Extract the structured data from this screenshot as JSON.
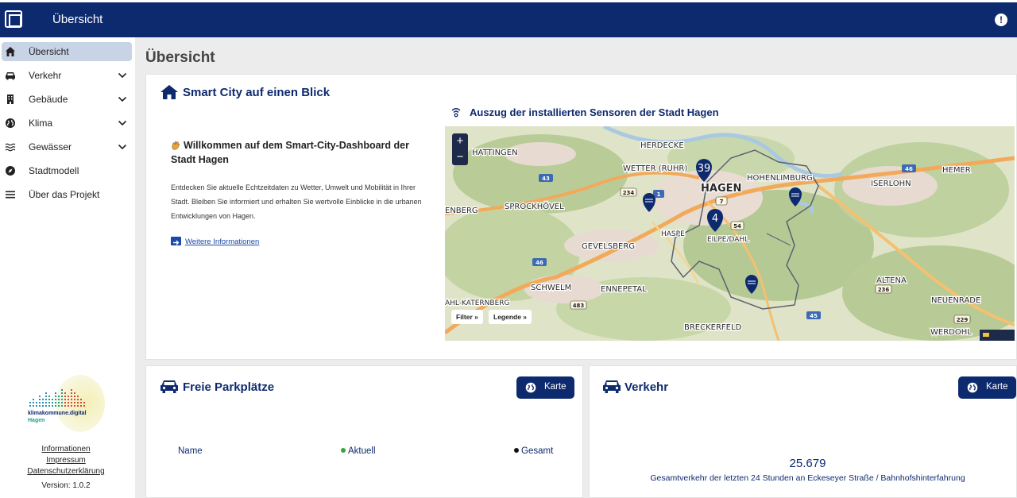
{
  "header": {
    "title": "Übersicht",
    "alert_icon": "alert-circle-icon"
  },
  "sidebar": {
    "items": [
      {
        "label": "Übersicht",
        "icon": "home-icon",
        "expandable": false,
        "active": true
      },
      {
        "label": "Verkehr",
        "icon": "car-icon",
        "expandable": true
      },
      {
        "label": "Gebäude",
        "icon": "building-icon",
        "expandable": true
      },
      {
        "label": "Klima",
        "icon": "globe-icon",
        "expandable": true
      },
      {
        "label": "Gewässer",
        "icon": "water-icon",
        "expandable": true
      },
      {
        "label": "Stadtmodell",
        "icon": "compass-icon",
        "expandable": false
      },
      {
        "label": "Über das Projekt",
        "icon": "menu-icon",
        "expandable": false
      }
    ],
    "logo_text": "klimakommune.digital",
    "logo_sub": "Hagen",
    "footer_links": [
      "Informationen",
      "Impressum",
      "Datenschutzerklärung"
    ],
    "version": "Version: 1.0.2"
  },
  "main": {
    "page_title": "Übersicht",
    "overview": {
      "title": "Smart City auf einen Blick",
      "welcome_title": "Willkommen auf dem Smart-City-Dashboard der Stadt Hagen",
      "welcome_text": "Entdecken Sie aktuelle Echtzeitdaten zu Wetter, Umwelt und Mobilität in Ihrer Stadt. Bleiben Sie informiert und erhalten Sie wertvolle Einblicke in die urbanen Entwicklungen von Hagen.",
      "more_link": "Weitere Informationen",
      "map_title": "Auszug der installierten Sensoren der Stadt Hagen",
      "map": {
        "zoom_in": "+",
        "zoom_out": "−",
        "filter_label": "Filter »",
        "legend_label": "Legende »",
        "cluster_a": "39",
        "cluster_b": "4",
        "places": [
          "HATTINGEN",
          "HERDECKE",
          "WETTER (RUHR)",
          "HAGEN",
          "HOHENLIMBURG",
          "HEMER",
          "ISERLOHN",
          "SPROCKHÖVEL",
          "GEVELSBERG",
          "HASPE",
          "EILPE/DAHL",
          "SCHWELM",
          "ENNEPETAL",
          "ALTENA",
          "NEUENRADE",
          "BRECKERFELD",
          "WERDOHL",
          "AHL-KATERNBERG",
          "ENBERG"
        ],
        "roads": [
          "43",
          "234",
          "1",
          "7",
          "54",
          "46",
          "483",
          "236",
          "229",
          "45"
        ]
      }
    },
    "parking": {
      "title": "Freie Parkplätze",
      "map_button": "Karte",
      "col_name": "Name",
      "col_current": "Aktuell",
      "col_total": "Gesamt",
      "current_color": "#3aa23a",
      "total_color": "#111111"
    },
    "traffic": {
      "title": "Verkehr",
      "map_button": "Karte",
      "value": "25.679",
      "description": "Gesamtverkehr der letzten 24 Stunden an Eckeseyer Straße / Bahnhofshinterfahrung"
    }
  }
}
